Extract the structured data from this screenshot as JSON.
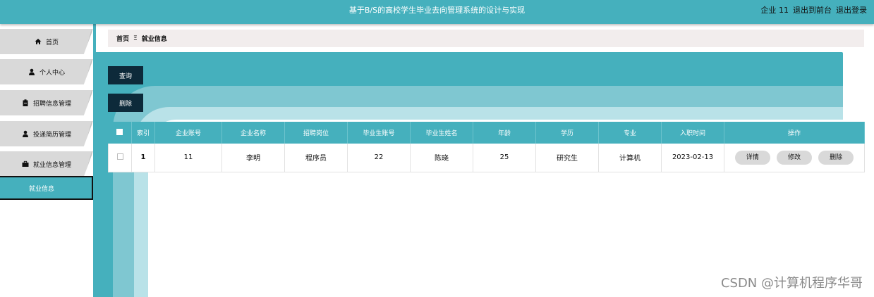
{
  "header": {
    "title": "基于B/S的高校学生毕业去向管理系统的设计与实现",
    "user_label": "企业 11",
    "front_link": "退出到前台",
    "logout_link": "退出登录"
  },
  "sidebar": {
    "items": [
      {
        "label": "首页",
        "icon": "home-icon"
      },
      {
        "label": "个人中心",
        "icon": "user-icon"
      },
      {
        "label": "招聘信息管理",
        "icon": "clipboard-icon"
      },
      {
        "label": "投递简历管理",
        "icon": "user-icon"
      },
      {
        "label": "就业信息管理",
        "icon": "briefcase-icon"
      }
    ],
    "active_sub": "就业信息"
  },
  "breadcrumb": {
    "home": "首页",
    "separator": "Ξ",
    "current": "就业信息"
  },
  "toolbar": {
    "query": "查询",
    "delete": "删除"
  },
  "table": {
    "columns": [
      "索引",
      "企业账号",
      "企业名称",
      "招聘岗位",
      "毕业生账号",
      "毕业生姓名",
      "年龄",
      "学历",
      "专业",
      "入职时间",
      "操作"
    ],
    "rows": [
      {
        "index": "1",
        "company_account": "11",
        "company_name": "李明",
        "position": "程序员",
        "grad_account": "22",
        "grad_name": "陈晓",
        "age": "25",
        "education": "研究生",
        "major": "计算机",
        "hire_date": "2023-02-13"
      }
    ],
    "actions": [
      "详情",
      "修改",
      "删除"
    ]
  },
  "watermark": "CSDN @计算机程序华哥",
  "colors": {
    "accent": "#45b0bd",
    "accent_light": "#7fc7d1",
    "accent_pale": "#b9e2e8",
    "button_dark": "#0d2a3a"
  }
}
